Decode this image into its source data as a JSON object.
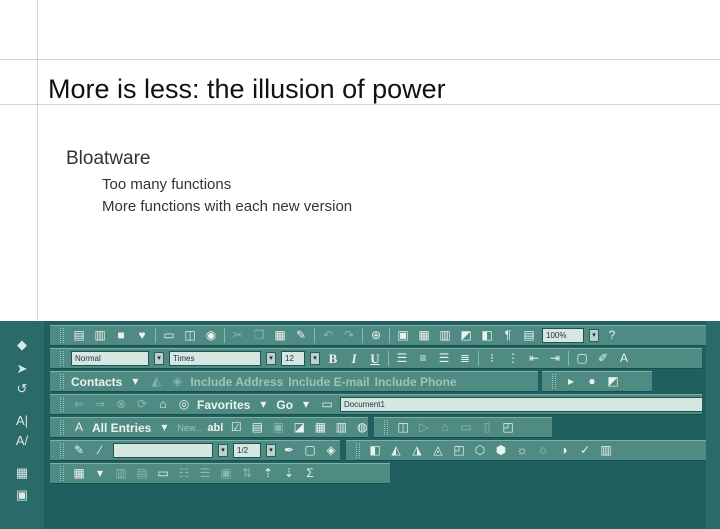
{
  "slide": {
    "title": "More is less: the illusion of power",
    "bullets": [
      {
        "text": "Bloatware",
        "level": 1
      },
      {
        "text": "Too many functions",
        "level": 2
      },
      {
        "text": "More functions with each new version",
        "level": 2
      }
    ]
  },
  "toolbars": {
    "standard": {
      "zoom": "100%"
    },
    "formatting": {
      "style": "Normal",
      "font": "Times",
      "size": "12",
      "bold": "B",
      "italic": "I",
      "underline": "U"
    },
    "contacts": {
      "contacts": "Contacts",
      "include_address": "Include Address",
      "include_email": "Include E-mail",
      "include_phone": "Include Phone"
    },
    "web": {
      "favorites": "Favorites",
      "go": "Go",
      "address": "Document1"
    },
    "autotext": {
      "all_entries": "All Entries",
      "new": "New...",
      "abl": "abl"
    },
    "drawing": {
      "page": "1/2"
    },
    "tables": {
      "sigma": "Σ"
    }
  },
  "icons": {
    "left_strip": [
      "cursor-icon",
      "text-icon",
      "pointer-icon",
      "lasso-icon",
      "text-frame-icon",
      "text-path-icon",
      "chart-icon",
      "screen-icon"
    ],
    "right_strip": [
      "table-icon",
      "grid-icon",
      "zoom-icon",
      "panel-icon"
    ]
  }
}
